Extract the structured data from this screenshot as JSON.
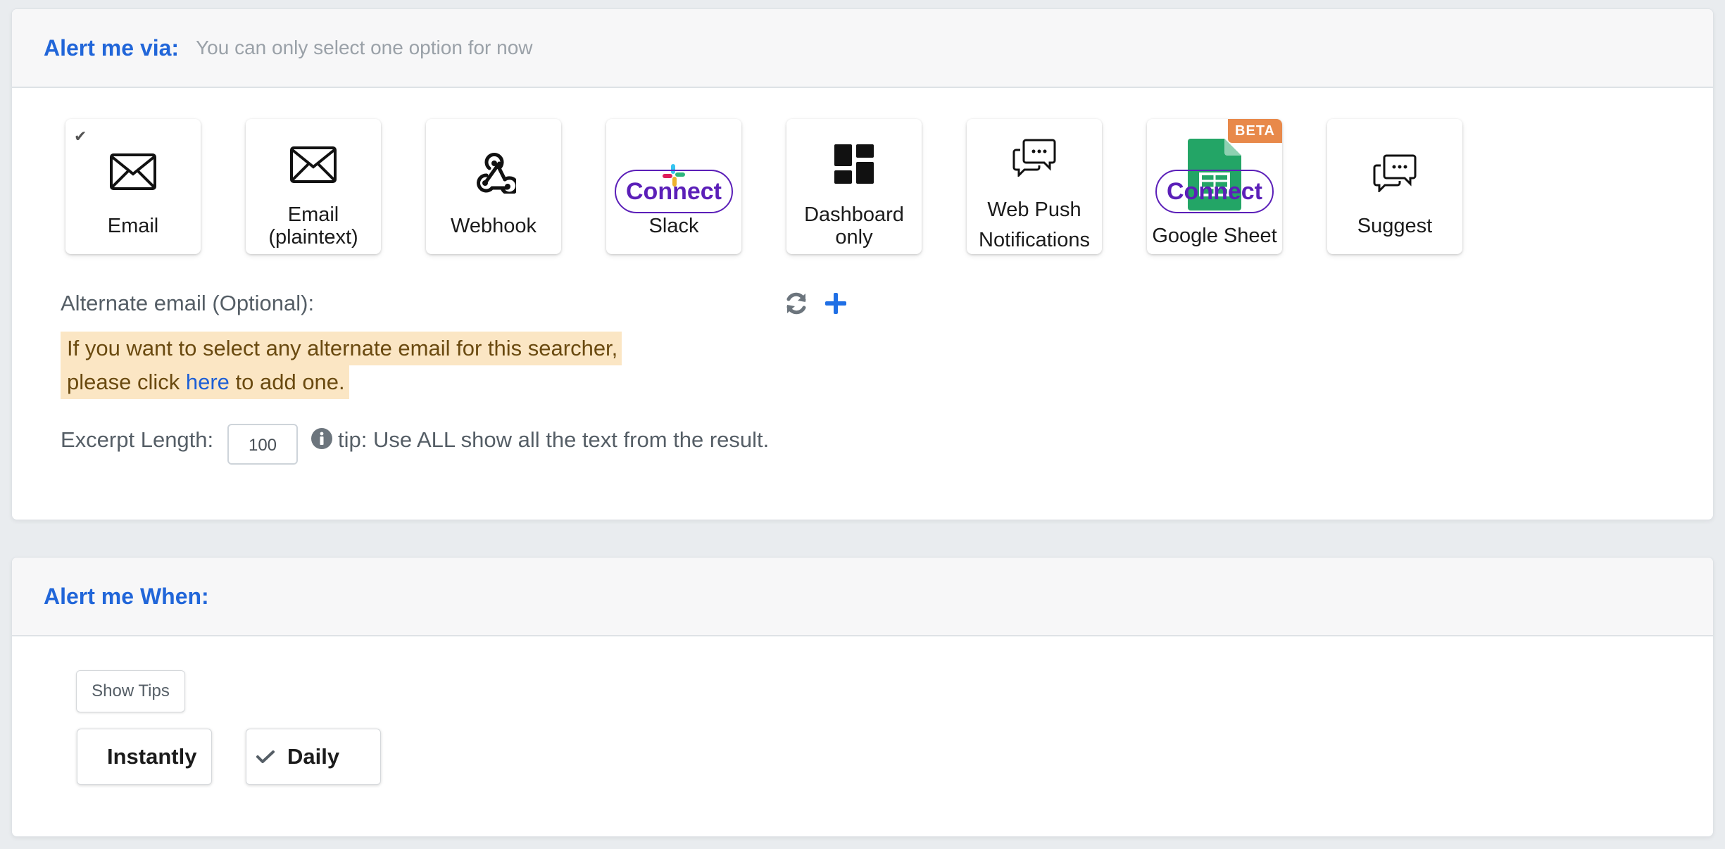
{
  "alert_via": {
    "title": "Alert me via:",
    "subtitle": "You can only select one option for now",
    "options": [
      {
        "label": "Email",
        "icon": "envelope-icon",
        "selected": true
      },
      {
        "label": "Email (plaintext)",
        "icon": "envelope-icon",
        "selected": false
      },
      {
        "label": "Webhook",
        "icon": "webhook-icon",
        "selected": false
      },
      {
        "label": "Slack",
        "icon": "slack-icon",
        "connect_label": "Connect",
        "selected": false
      },
      {
        "label": "Dashboard only",
        "icon": "dashboard-icon",
        "selected": false
      },
      {
        "label": "Web Push Notifications",
        "icon": "chat-bubbles-icon",
        "selected": false
      },
      {
        "label": "Google Sheet",
        "icon": "google-sheets-icon",
        "connect_label": "Connect",
        "badge": "BETA",
        "selected": false
      },
      {
        "label": "Suggest",
        "icon": "chat-bubbles-icon",
        "selected": false
      }
    ],
    "alternate_email": {
      "label": "Alternate email (Optional):",
      "alert_line1": "If you want to select any alternate email for this searcher,",
      "alert_line2_before": "please click ",
      "alert_link": "here",
      "alert_line2_after": " to add one."
    },
    "excerpt": {
      "label": "Excerpt Length:",
      "value": "100",
      "tip": "tip: Use ALL show all the text from the result."
    }
  },
  "alert_when": {
    "title": "Alert me When:",
    "show_tips_label": "Show Tips",
    "frequency_options": [
      {
        "label": "Instantly",
        "selected": false
      },
      {
        "label": "Daily",
        "selected": true
      }
    ]
  },
  "colors": {
    "accent": "#2166d9",
    "connect": "#5b1fb8",
    "beta": "#e8894a",
    "alert_bg": "#fbe6c4",
    "sheets_green": "#23a566"
  }
}
